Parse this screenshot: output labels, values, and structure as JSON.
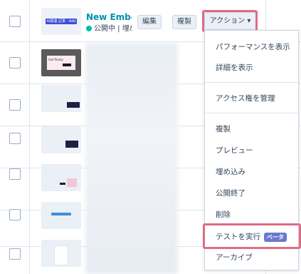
{
  "row1": {
    "title": "New Embed",
    "status": "公開中 | 埋め",
    "edit_label": "編集",
    "clone_label": "複製",
    "actions_label": "アクション ▾",
    "thumb_text": "AI関連 記事 · Add"
  },
  "thumb2_text": "Get Ready",
  "menu": {
    "items": [
      {
        "label": "パフォーマンスを表示"
      },
      {
        "label": "詳細を表示"
      },
      {
        "label": "アクセス権を管理"
      },
      {
        "label": "複製"
      },
      {
        "label": "プレビュー"
      },
      {
        "label": "埋め込み"
      },
      {
        "label": "公開終了"
      },
      {
        "label": "削除"
      },
      {
        "label": "テストを実行",
        "badge": "ベータ"
      },
      {
        "label": "アーカイブ"
      }
    ]
  },
  "colors": {
    "link": "#0091ae",
    "highlight": "#e06b84",
    "badge": "#6a78d1",
    "status_dot": "#00bda5"
  }
}
